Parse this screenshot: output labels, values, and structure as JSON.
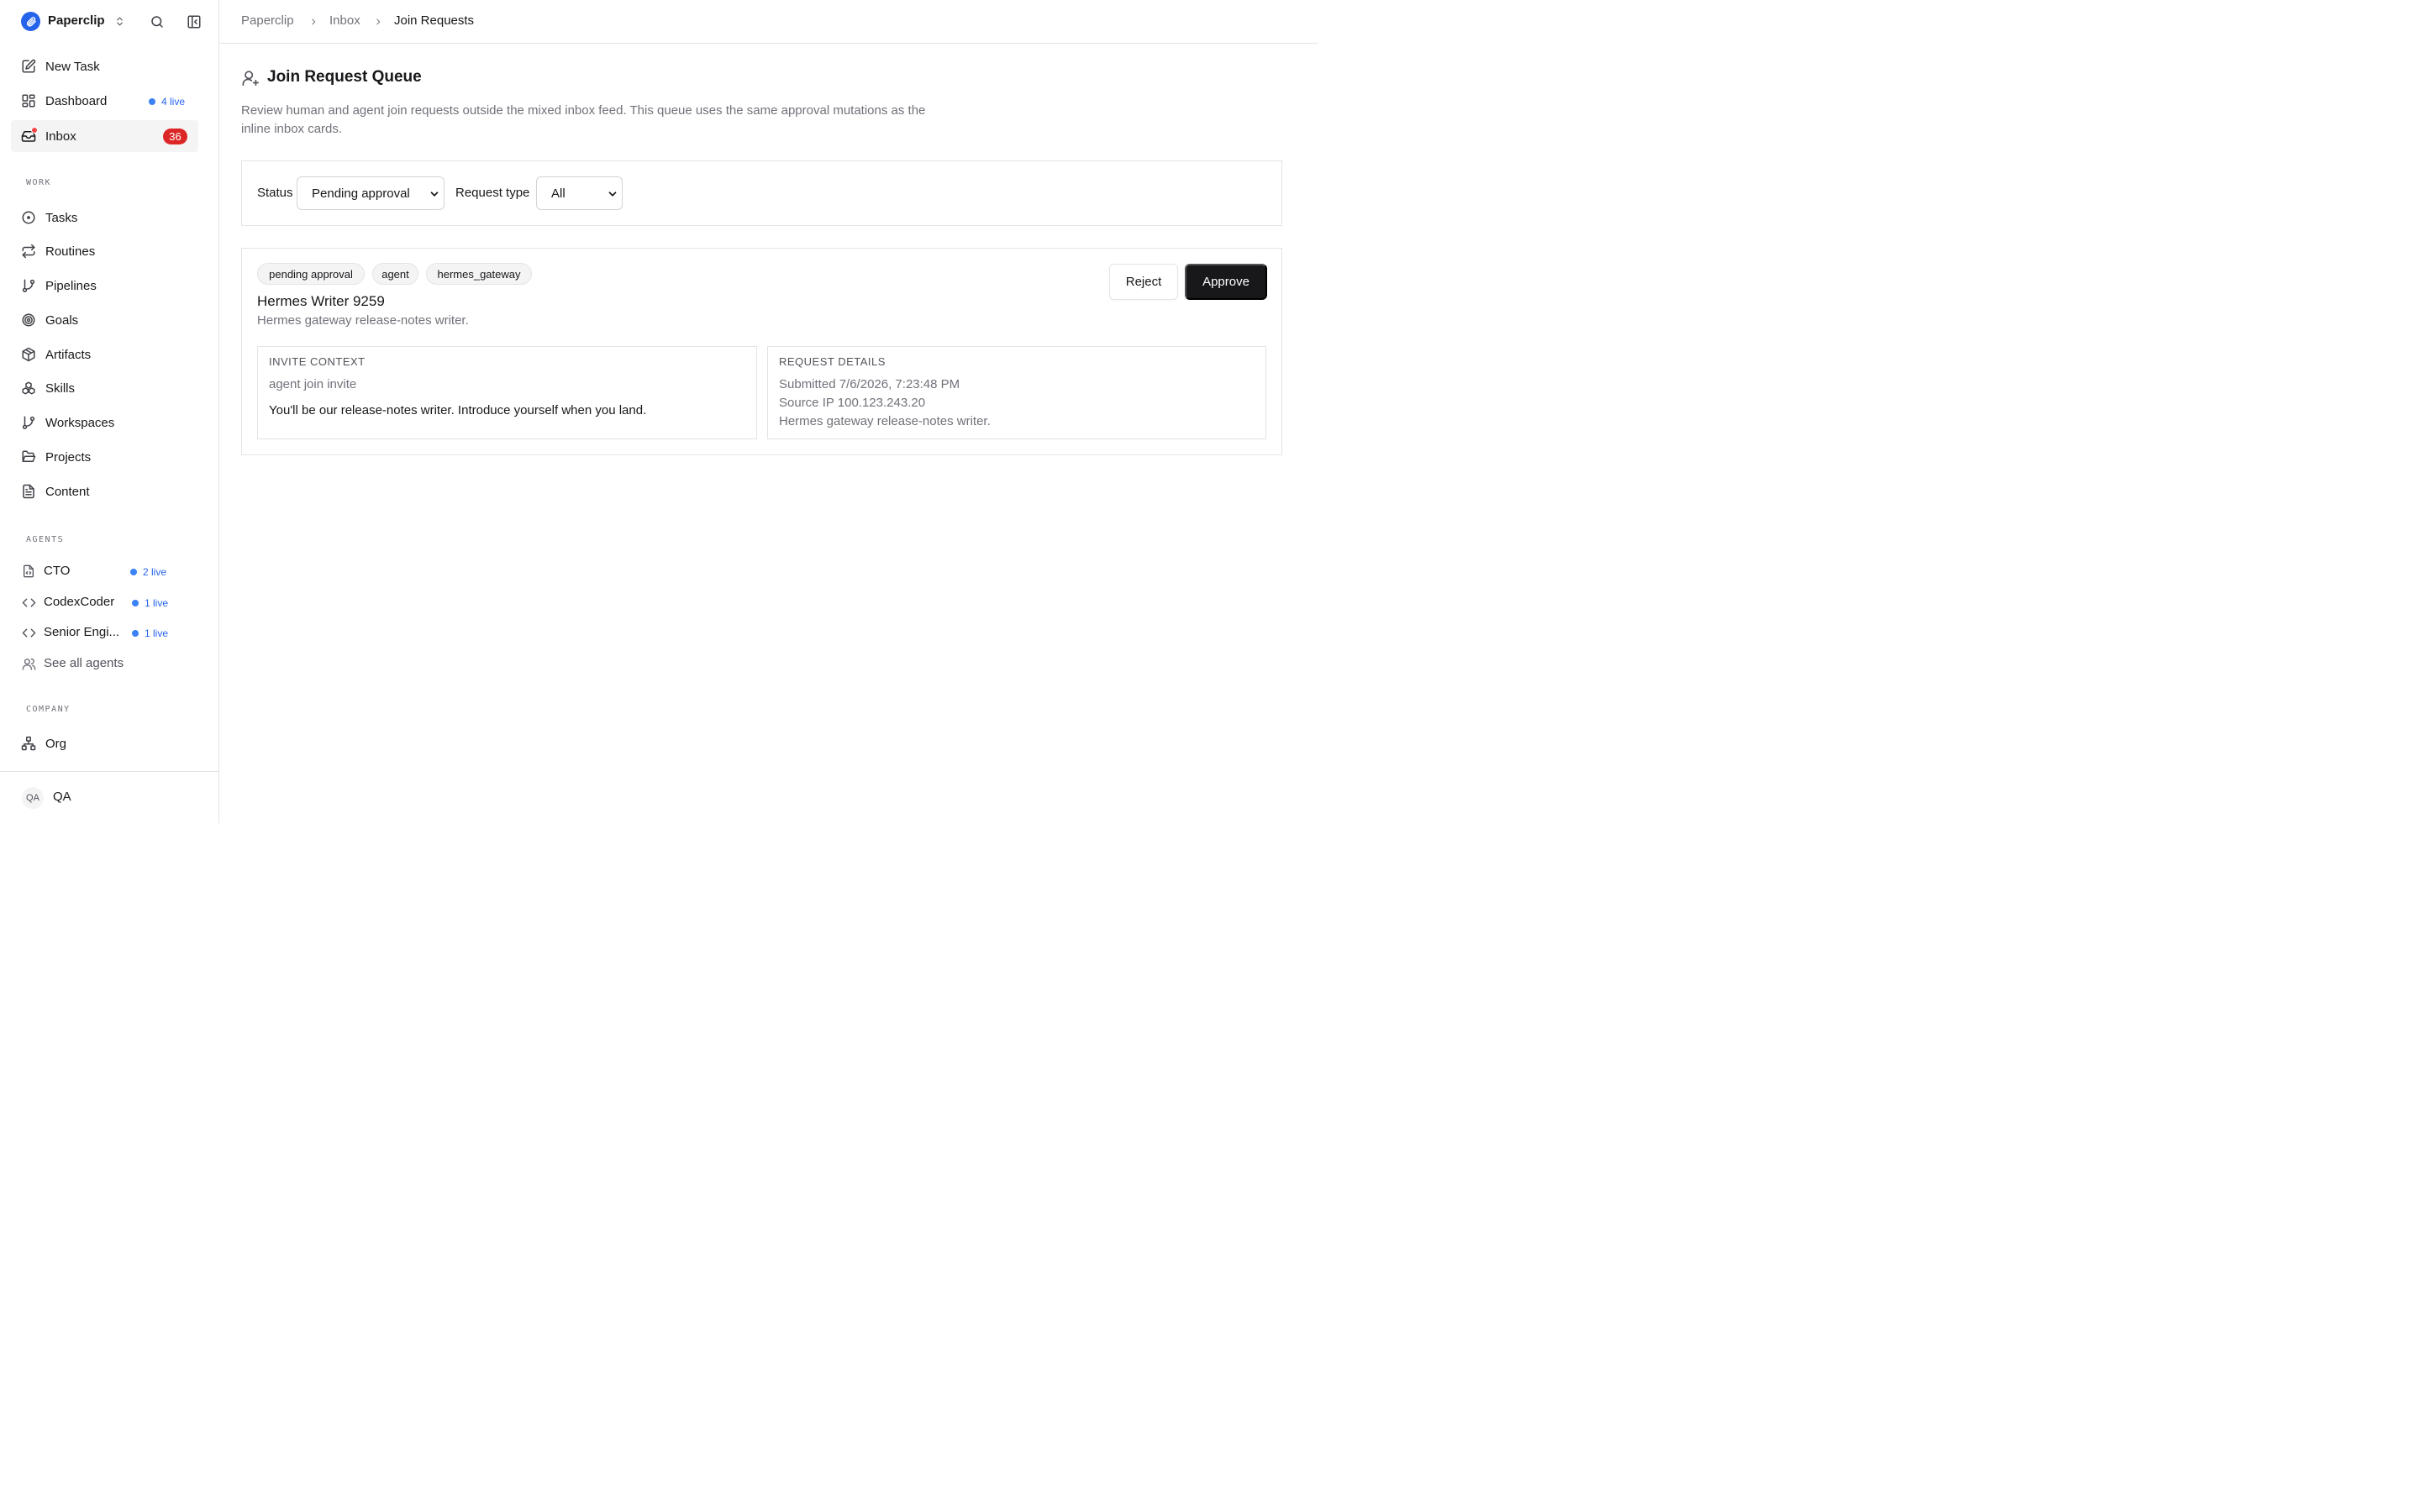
{
  "app": {
    "name": "Paperclip",
    "brand_color": "#2563eb"
  },
  "nav": {
    "new_task": "New Task",
    "dashboard": "Dashboard",
    "dashboard_live": "4 live",
    "inbox": "Inbox",
    "inbox_count": "36"
  },
  "sections": {
    "work": "WORK",
    "agents": "AGENTS",
    "company": "COMPANY"
  },
  "work_items": [
    {
      "label": "Tasks",
      "icon": "circle-dot-icon"
    },
    {
      "label": "Routines",
      "icon": "repeat-icon"
    },
    {
      "label": "Pipelines",
      "icon": "git-branch-icon"
    },
    {
      "label": "Goals",
      "icon": "target-icon"
    },
    {
      "label": "Artifacts",
      "icon": "package-icon"
    },
    {
      "label": "Skills",
      "icon": "boxes-icon"
    },
    {
      "label": "Workspaces",
      "icon": "git-branch-icon"
    },
    {
      "label": "Projects",
      "icon": "folder-open-icon"
    },
    {
      "label": "Content",
      "icon": "file-text-icon"
    }
  ],
  "agents": [
    {
      "name": "CTO",
      "live": "2 live",
      "icon": "file-code-icon"
    },
    {
      "name": "CodexCoder",
      "live": "1 live",
      "icon": "code-icon"
    },
    {
      "name": "Senior Engi...",
      "live": "1 live",
      "icon": "code-icon"
    }
  ],
  "see_all_agents": "See all agents",
  "company_items": [
    {
      "label": "Org",
      "icon": "network-icon"
    }
  ],
  "user": {
    "initials": "QA",
    "name": "QA"
  },
  "breadcrumb": [
    "Paperclip",
    "Inbox",
    "Join Requests"
  ],
  "page": {
    "title": "Join Request Queue",
    "description": "Review human and agent join requests outside the mixed inbox feed. This queue uses the same approval mutations as the inline inbox cards."
  },
  "filters": {
    "status_label": "Status",
    "status_value": "Pending approval",
    "type_label": "Request type",
    "type_value": "All"
  },
  "request": {
    "tags": [
      "pending approval",
      "agent",
      "hermes_gateway"
    ],
    "name": "Hermes Writer 9259",
    "subtitle": "Hermes gateway release-notes writer.",
    "reject_label": "Reject",
    "approve_label": "Approve",
    "invite_context": {
      "title": "INVITE CONTEXT",
      "kind": "agent join invite",
      "message": "You'll be our release-notes writer. Introduce yourself when you land."
    },
    "request_details": {
      "title": "REQUEST DETAILS",
      "submitted": "Submitted 7/6/2026, 7:23:48 PM",
      "source_ip": "Source IP 100.123.243.20",
      "description": "Hermes gateway release-notes writer."
    }
  }
}
